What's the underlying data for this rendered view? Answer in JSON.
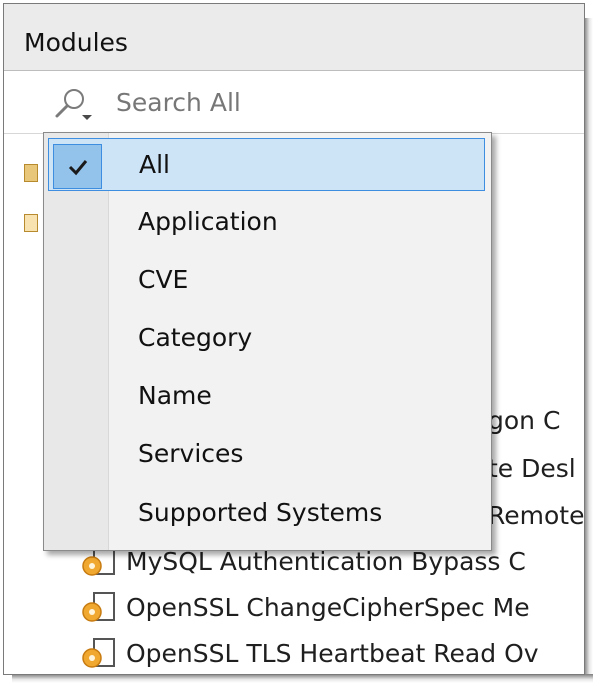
{
  "panel": {
    "title": "Modules",
    "search": {
      "placeholder": "Search All",
      "value": ""
    }
  },
  "dropdown": {
    "selected": "All",
    "items": [
      {
        "label": "All",
        "checked": true
      },
      {
        "label": "Application",
        "checked": false
      },
      {
        "label": "CVE",
        "checked": false
      },
      {
        "label": "Category",
        "checked": false
      },
      {
        "label": "Name",
        "checked": false
      },
      {
        "label": "Services",
        "checked": false
      },
      {
        "label": "Supported Systems",
        "checked": false
      }
    ]
  },
  "tree": {
    "partial_items": [
      "gon C",
      "te Desl",
      "Remote"
    ],
    "items": [
      {
        "label": "MySQL Authentication Bypass C",
        "icon": "module-gear-icon"
      },
      {
        "label": "OpenSSL ChangeCipherSpec Me",
        "icon": "module-gear-icon"
      },
      {
        "label": "OpenSSL TLS Heartbeat Read Ov",
        "icon": "module-gear-icon"
      }
    ]
  },
  "colors": {
    "header_bg": "#ebebeb",
    "selection_bg": "#cde4f7",
    "selection_border": "#3d8ee0",
    "check_bg": "#93c2ea",
    "icon_gear": "#f0a830"
  }
}
